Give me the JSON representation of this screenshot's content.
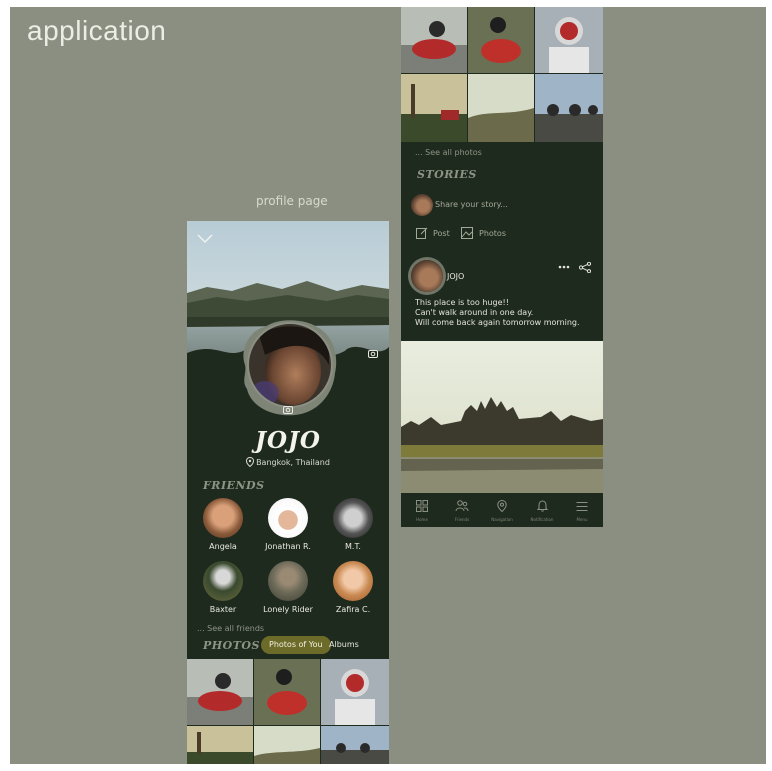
{
  "canvas_title": "application",
  "caption": "profile page",
  "profile": {
    "name": "JOJO",
    "location": "Bangkok, Thailand",
    "friends_heading": "FRIENDS",
    "friends": [
      {
        "name": "Angela"
      },
      {
        "name": "Jonathan R."
      },
      {
        "name": "M.T."
      },
      {
        "name": "Baxter"
      },
      {
        "name": "Lonely Rider"
      },
      {
        "name": "Zafira C."
      }
    ],
    "see_all_friends": "... See all friends",
    "photos_heading": "PHOTOS",
    "photo_tabs": [
      "Photos of You",
      "Albums"
    ]
  },
  "feed": {
    "see_all_photos": "... See all photos",
    "stories_heading": "STORIES",
    "story_placeholder": "Share your story...",
    "actions": [
      "Post",
      "Photos"
    ],
    "post": {
      "author": "JOJO",
      "lines": [
        "This place is too huge!!",
        "Can't walk around in one day.",
        "Will come back again tomorrow morning."
      ]
    }
  },
  "nav": [
    {
      "label": "Home",
      "icon": "grid-icon"
    },
    {
      "label": "Friends",
      "icon": "friends-icon"
    },
    {
      "label": "Navigation",
      "icon": "location-pin-icon"
    },
    {
      "label": "Notification",
      "icon": "bell-icon"
    },
    {
      "label": "Menu",
      "icon": "menu-icon"
    }
  ],
  "colors": {
    "canvas": "#8b8f82",
    "phone_bg": "#1f2a1e",
    "accent_pill": "#6d6b2a",
    "heading": "#8e9485"
  }
}
